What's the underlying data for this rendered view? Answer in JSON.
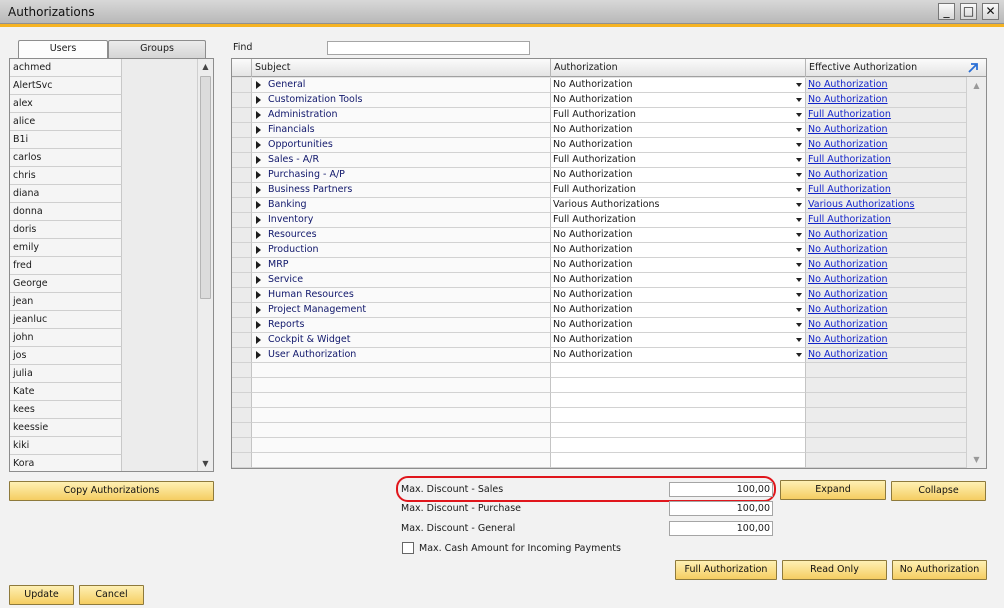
{
  "window": {
    "title": "Authorizations",
    "minimize_glyph": "_",
    "maximize_glyph": "□",
    "close_glyph": "✕"
  },
  "tabs": [
    {
      "label": "Users",
      "active": true
    },
    {
      "label": "Groups",
      "active": false
    }
  ],
  "users": [
    "achmed",
    "AlertSvc",
    "alex",
    "alice",
    "B1i",
    "carlos",
    "chris",
    "diana",
    "donna",
    "doris",
    "emily",
    "fred",
    "George",
    "jean",
    "jeanluc",
    "john",
    "jos",
    "julia",
    "Kate",
    "kees",
    "keessie",
    "kiki",
    "Kora"
  ],
  "find": {
    "label": "Find",
    "value": ""
  },
  "grid": {
    "headers": {
      "subject": "Subject",
      "authorization": "Authorization",
      "effective": "Effective Authorization"
    },
    "rows": [
      {
        "subject": "General",
        "auth": "No Authorization",
        "effective": "No Authorization"
      },
      {
        "subject": "Customization Tools",
        "auth": "No Authorization",
        "effective": "No Authorization"
      },
      {
        "subject": "Administration",
        "auth": "Full Authorization",
        "effective": "Full Authorization"
      },
      {
        "subject": "Financials",
        "auth": "No Authorization",
        "effective": "No Authorization"
      },
      {
        "subject": "Opportunities",
        "auth": "No Authorization",
        "effective": "No Authorization"
      },
      {
        "subject": "Sales - A/R",
        "auth": "Full Authorization",
        "effective": "Full Authorization"
      },
      {
        "subject": "Purchasing - A/P",
        "auth": "No Authorization",
        "effective": "No Authorization"
      },
      {
        "subject": "Business Partners",
        "auth": "Full Authorization",
        "effective": "Full Authorization"
      },
      {
        "subject": "Banking",
        "auth": "Various Authorizations",
        "effective": "Various Authorizations"
      },
      {
        "subject": "Inventory",
        "auth": "Full Authorization",
        "effective": "Full Authorization"
      },
      {
        "subject": "Resources",
        "auth": "No Authorization",
        "effective": "No Authorization"
      },
      {
        "subject": "Production",
        "auth": "No Authorization",
        "effective": "No Authorization"
      },
      {
        "subject": "MRP",
        "auth": "No Authorization",
        "effective": "No Authorization"
      },
      {
        "subject": "Service",
        "auth": "No Authorization",
        "effective": "No Authorization"
      },
      {
        "subject": "Human Resources",
        "auth": "No Authorization",
        "effective": "No Authorization"
      },
      {
        "subject": "Project Management",
        "auth": "No Authorization",
        "effective": "No Authorization"
      },
      {
        "subject": "Reports",
        "auth": "No Authorization",
        "effective": "No Authorization"
      },
      {
        "subject": "Cockpit & Widget",
        "auth": "No Authorization",
        "effective": "No Authorization"
      },
      {
        "subject": "User Authorization",
        "auth": "No Authorization",
        "effective": "No Authorization"
      }
    ]
  },
  "discounts": {
    "sales": {
      "label": "Max. Discount - Sales",
      "value": "100,00"
    },
    "purchase": {
      "label": "Max. Discount - Purchase",
      "value": "100,00"
    },
    "general": {
      "label": "Max. Discount - General",
      "value": "100,00"
    }
  },
  "max_cash": {
    "label": "Max. Cash Amount for Incoming Payments",
    "checked": false
  },
  "buttons": {
    "copy": "Copy Authorizations",
    "expand": "Expand",
    "collapse": "Collapse",
    "full": "Full Authorization",
    "read_only": "Read Only",
    "no_auth": "No Authorization",
    "update": "Update",
    "cancel": "Cancel"
  },
  "colors": {
    "accent": "#f5b323",
    "button": "#f5cd62",
    "link": "#1224c9",
    "highlight": "#e0161c"
  }
}
